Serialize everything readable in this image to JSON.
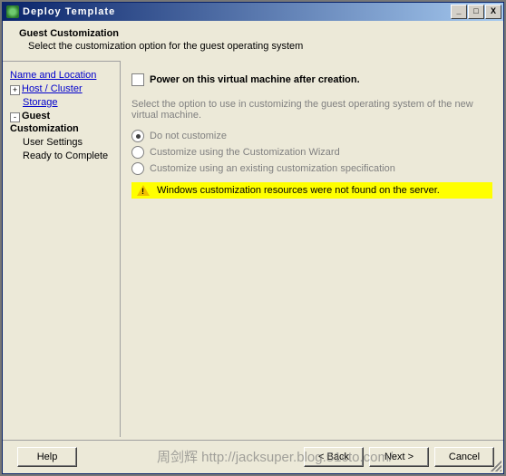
{
  "window": {
    "title": "Deploy Template"
  },
  "header": {
    "title": "Guest Customization",
    "subtitle": "Select the customization option for the guest operating system"
  },
  "sidebar": {
    "items": [
      {
        "label": "Name and Location",
        "link": true
      },
      {
        "label": "Host / Cluster",
        "link": true,
        "toggle": "+"
      },
      {
        "label": "Storage",
        "link": true,
        "indent": true
      },
      {
        "label": "Guest Customization",
        "current": true,
        "toggle": "-"
      },
      {
        "label": "User Settings",
        "indent": true
      },
      {
        "label": "Ready to Complete",
        "indent": true
      }
    ]
  },
  "content": {
    "power_on_label": "Power on this virtual machine after creation.",
    "description": "Select the option to use in customizing the guest operating system of the new virtual machine.",
    "options": [
      {
        "label": "Do not customize",
        "selected": true
      },
      {
        "label": "Customize using the Customization Wizard",
        "selected": false
      },
      {
        "label": "Customize using an existing customization specification",
        "selected": false
      }
    ],
    "warning": "Windows customization resources were not found on the server."
  },
  "footer": {
    "help": "Help",
    "back": "< Back",
    "next": "Next >",
    "cancel": "Cancel"
  },
  "watermark": "周剑辉 http://jacksuper.blog.51cto.com/"
}
